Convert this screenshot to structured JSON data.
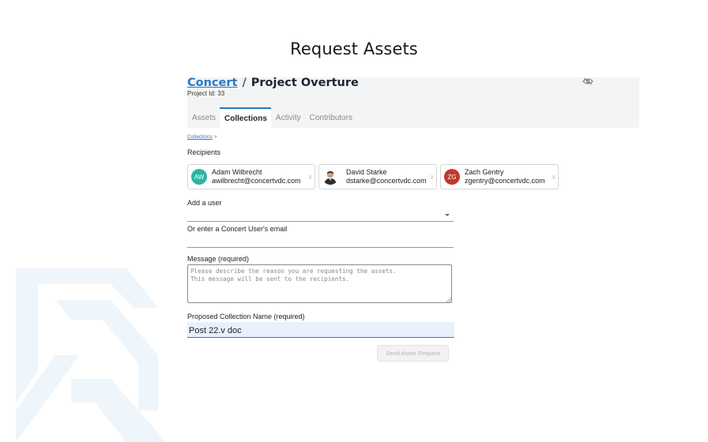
{
  "page": {
    "heading": "Request Assets"
  },
  "header": {
    "org_name": "Concert",
    "separator": "/",
    "project_name": "Project Overture",
    "project_id": "Project Id: 33",
    "icons": {
      "visibility_toggle": "eye-slash-icon"
    }
  },
  "tabs": [
    {
      "label": "Assets",
      "active": false
    },
    {
      "label": "Collections",
      "active": true
    },
    {
      "label": "Activity",
      "active": false
    },
    {
      "label": "Contributors",
      "active": false
    }
  ],
  "breadcrumb": {
    "link": "Collections",
    "separator": ">"
  },
  "recipients": {
    "label": "Recipients",
    "remove_symbol": "x",
    "items": [
      {
        "initials": "AW",
        "avatar_color": "#2bb5a0",
        "name": "Adam Wilbrecht",
        "email": "awilbrecht@concertvdc.com"
      },
      {
        "initials": "",
        "avatar_type": "photo",
        "name": "David Starke",
        "email": "dstarke@concertvdc.com"
      },
      {
        "initials": "ZG",
        "avatar_color": "#c0392b",
        "name": "Zach Gentry",
        "email": "zgentry@concertvdc.com"
      }
    ]
  },
  "add_user": {
    "label": "Add a user",
    "value": ""
  },
  "email_entry": {
    "label": "Or enter a Concert User's email",
    "value": ""
  },
  "message": {
    "label": "Message (required)",
    "placeholder": "Please describe the reason you are requesting the assets.\nThis message will be sent to the recipients.",
    "value": ""
  },
  "collection_name": {
    "label": "Proposed Collection Name (required)",
    "value": "Post 22.v doc"
  },
  "send_button": {
    "label": "Send Asset Request",
    "enabled": false
  },
  "colors": {
    "accent": "#2b78c5",
    "header_bg": "#f3f4f6",
    "autofill_bg": "#e8f0fe",
    "watermark": "#eef5fb"
  }
}
